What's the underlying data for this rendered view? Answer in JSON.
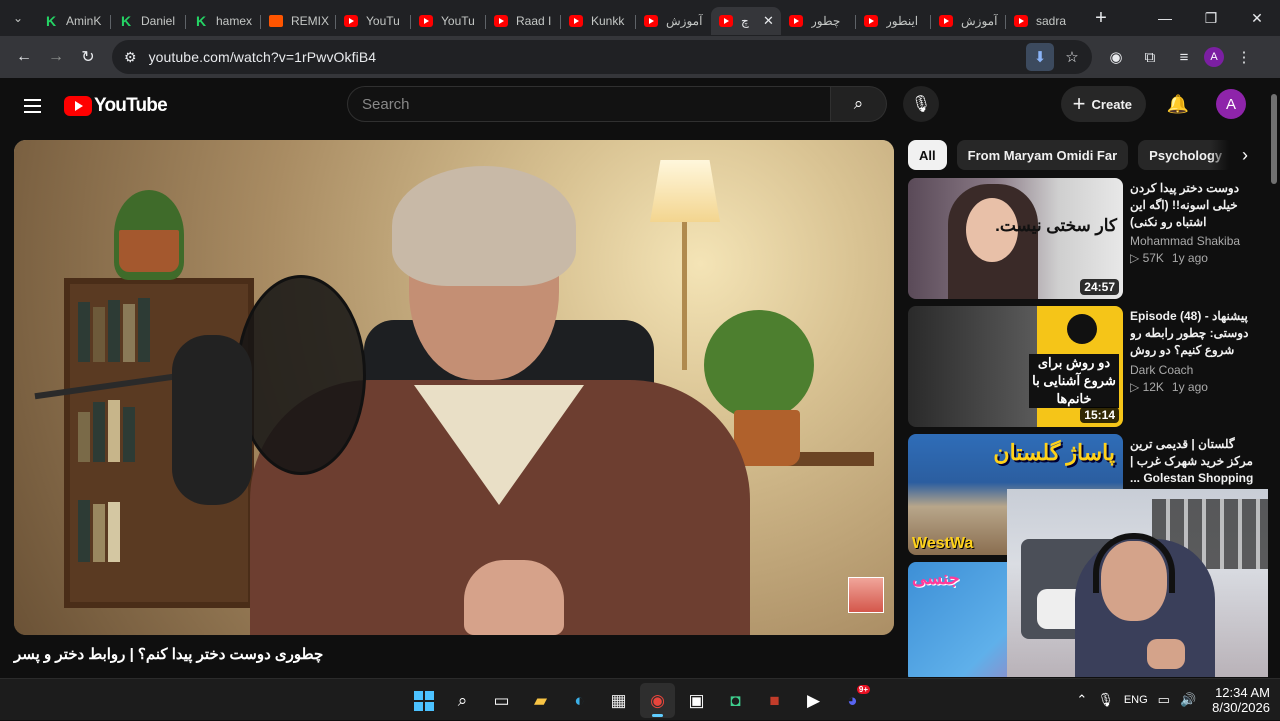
{
  "browser": {
    "tabs": [
      {
        "label": "AminK",
        "icon": "kick"
      },
      {
        "label": "Daniel",
        "icon": "kick"
      },
      {
        "label": "hamex",
        "icon": "kick"
      },
      {
        "label": "REMIX",
        "icon": "soundcloud"
      },
      {
        "label": "YouTu",
        "icon": "youtube"
      },
      {
        "label": "YouTu",
        "icon": "youtube"
      },
      {
        "label": "Raad I",
        "icon": "youtube"
      },
      {
        "label": "Kunkk",
        "icon": "youtube"
      },
      {
        "label": "آموزش",
        "icon": "youtube"
      },
      {
        "label": "چ",
        "icon": "youtube",
        "active": true
      },
      {
        "label": "چطور",
        "icon": "youtube"
      },
      {
        "label": "اینطور",
        "icon": "youtube"
      },
      {
        "label": "آموزش",
        "icon": "youtube"
      },
      {
        "label": "sadra",
        "icon": "youtube"
      }
    ],
    "url": "youtube.com/watch?v=1rPwvOkfiB4",
    "profile_initial": "A"
  },
  "youtube": {
    "logo_text": "YouTube",
    "search_placeholder": "Search",
    "create_label": "Create",
    "avatar_initial": "A",
    "video_title": "چطوری دوست دختر پیدا کنم؟ | روابط دختر و پسر",
    "chips": [
      "All",
      "From Maryam Omidi Far",
      "Psychology"
    ],
    "recommendations": [
      {
        "title": "دوست دختر پیدا کردن خیلی اسونه!! (اگه این اشتباه رو نکنی)",
        "channel": "Mohammad Shakiba",
        "views": "57K",
        "age": "1y ago",
        "duration": "24:57",
        "thumb_text": "کار سختی نیست."
      },
      {
        "title": "پیشنهاد - Episode (48) دوستی: چطور رابطه رو شروع کنیم؟ دو روش برای ...",
        "channel": "Dark Coach",
        "views": "12K",
        "age": "1y ago",
        "duration": "15:14",
        "thumb_text": "دو روش برای شروع آشنایی با خانم‌ها"
      },
      {
        "title": "گلستان | قدیمی ترین مرکز خرید شهرک غرب | Golestan Shopping ...",
        "channel": "",
        "views": "",
        "age": "",
        "duration": "",
        "thumb_text": "پاساژ گلستان",
        "thumb_text2": "WestWa"
      },
      {
        "title": "",
        "channel": "",
        "views": "",
        "age": "",
        "duration": "",
        "thumb_text": "جنسی"
      }
    ]
  },
  "taskbar": {
    "language": "ENG",
    "time": "12:34 AM",
    "date": "8/30/2026",
    "discord_badge": "9+"
  },
  "colors": {
    "youtube_red": "#ff0000",
    "background": "#0f0f0f",
    "chrome_dark": "#202124"
  }
}
